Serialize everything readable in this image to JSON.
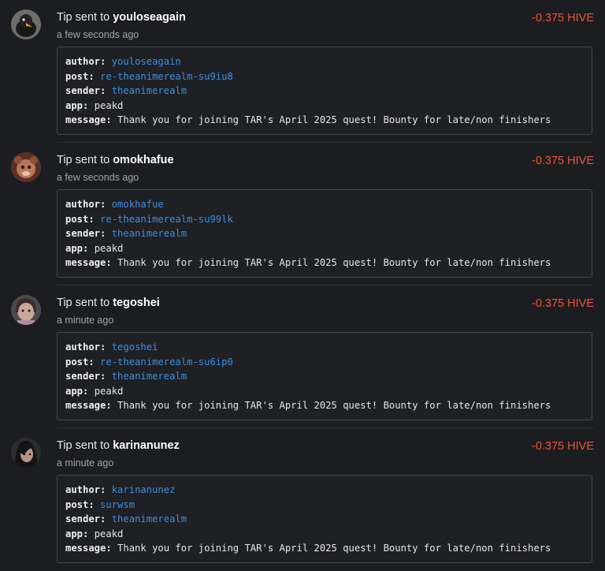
{
  "colors": {
    "background": "#1c1d21",
    "amount_negative": "#f05336",
    "link": "#3b8fe0",
    "box_border": "#45464b"
  },
  "labels": {
    "tip_sent_to": "Tip sent to ",
    "author": "author:",
    "post": "post:",
    "sender": "sender:",
    "app": "app:",
    "message": "message:"
  },
  "transactions": [
    {
      "avatar_icon": "crow-avatar-icon",
      "recipient": "youloseagain",
      "time": "a few seconds ago",
      "amount": "-0.375 HIVE",
      "author": "youloseagain",
      "post": "re-theanimerealm-su9iu8",
      "sender": "theanimerealm",
      "app": "peakd",
      "message": "Thank you for joining TAR's April 2025 quest! Bounty for late/non finishers"
    },
    {
      "avatar_icon": "plush-creature-avatar-icon",
      "recipient": "omokhafue",
      "time": "a few seconds ago",
      "amount": "-0.375 HIVE",
      "author": "omokhafue",
      "post": "re-theanimerealm-su99lk",
      "sender": "theanimerealm",
      "app": "peakd",
      "message": "Thank you for joining TAR's April 2025 quest! Bounty for late/non finishers"
    },
    {
      "avatar_icon": "portrait-avatar-icon",
      "recipient": "tegoshei",
      "time": "a minute ago",
      "amount": "-0.375 HIVE",
      "author": "tegoshei",
      "post": "re-theanimerealm-su6ip0",
      "sender": "theanimerealm",
      "app": "peakd",
      "message": "Thank you for joining TAR's April 2025 quest! Bounty for late/non finishers"
    },
    {
      "avatar_icon": "portrait-avatar-icon",
      "recipient": "karinanunez",
      "time": "a minute ago",
      "amount": "-0.375 HIVE",
      "author": "karinanunez",
      "post": "surwsm",
      "sender": "theanimerealm",
      "app": "peakd",
      "message": "Thank you for joining TAR's April 2025 quest! Bounty for late/non finishers"
    }
  ]
}
